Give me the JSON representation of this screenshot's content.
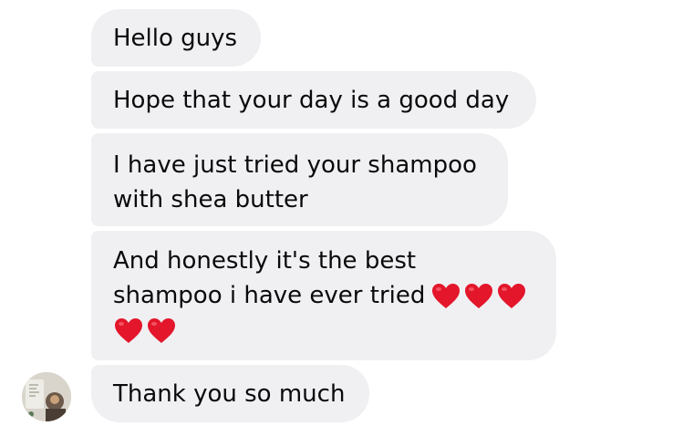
{
  "messages": [
    {
      "text": "Hello guys"
    },
    {
      "text": "Hope that your day is a good day"
    },
    {
      "lines": [
        "I have just tried your shampoo",
        "with shea butter"
      ]
    },
    {
      "lines": [
        "And honestly it's the best",
        "shampoo i have ever tried"
      ],
      "emoji": "red-heart",
      "emoji_count": 5
    },
    {
      "text": "Thank you so much"
    }
  ],
  "colors": {
    "bubble_bg": "#f0f0f3",
    "text": "#0a0a0a",
    "heart": "#e3162b"
  },
  "icons": {
    "avatar": "contact-avatar",
    "heart": "red-heart-icon"
  }
}
